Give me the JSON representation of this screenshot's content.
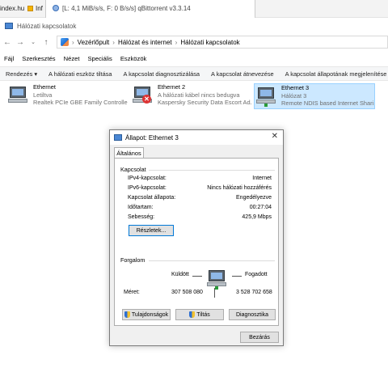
{
  "taskbar": {
    "item1": "index.hu",
    "item2": "Inf",
    "item3": "[L: 4,1 MiB/s/s, F: 0 B/s/s] qBittorrent v3.3.14"
  },
  "window": {
    "title": "Hálózati kapcsolatok",
    "breadcrumb": [
      "Vezérlőpult",
      "Hálózat és internet",
      "Hálózati kapcsolatok"
    ],
    "menu": [
      "Fájl",
      "Szerkesztés",
      "Nézet",
      "Speciális",
      "Eszközök"
    ],
    "commands": [
      "Rendezés ▾",
      "A hálózati eszköz tiltása",
      "A kapcsolat diagnosztizálása",
      "A kapcsolat átnevezése",
      "A kapcsolat állapotának megjelenítése"
    ]
  },
  "adapters": [
    {
      "name": "Ethernet",
      "status": "Letiltva",
      "device": "Realtek PCIe GBE Family Controller"
    },
    {
      "name": "Ethernet 2",
      "status": "A hálózati kábel nincs bedugva",
      "device": "Kaspersky Security Data Escort Ad..."
    },
    {
      "name": "Ethernet 3",
      "status": "Hálózat 3",
      "device": "Remote NDIS based Internet Shari..."
    }
  ],
  "dialog": {
    "title": "Állapot: Ethernet 3",
    "close": "✕",
    "tab": "Általános",
    "connection_group": "Kapcsolat",
    "rows": [
      {
        "label": "IPv4-kapcsolat:",
        "value": "Internet"
      },
      {
        "label": "IPv6-kapcsolat:",
        "value": "Nincs hálózati hozzáférés"
      },
      {
        "label": "Kapcsolat állapota:",
        "value": "Engedélyezve"
      },
      {
        "label": "Időtartam:",
        "value": "00:27:04"
      },
      {
        "label": "Sebesség:",
        "value": "425,9 Mbps"
      }
    ],
    "details_button": "Részletek...",
    "traffic_group": "Forgalom",
    "sent_label": "Küldött",
    "received_label": "Fogadott",
    "bytes_label": "Méret:",
    "bytes_sent": "307 508 080",
    "bytes_received": "3 528 702 658",
    "properties_button": "Tulajdonságok",
    "disable_button": "Tiltás",
    "diagnose_button": "Diagnosztika",
    "close_button": "Bezárás"
  }
}
